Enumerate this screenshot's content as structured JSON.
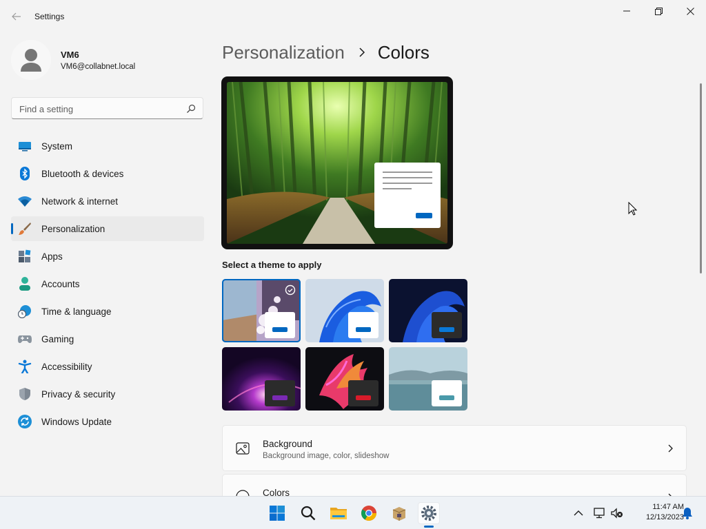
{
  "window": {
    "title": "Settings",
    "back_icon": "back-arrow-icon",
    "controls": [
      "minimize-icon",
      "restore-icon",
      "close-icon"
    ]
  },
  "profile": {
    "name": "VM6",
    "email": "VM6@collabnet.local"
  },
  "search": {
    "placeholder": "Find a setting",
    "value": ""
  },
  "nav": {
    "items": [
      {
        "label": "System",
        "icon": "system-icon",
        "selected": false
      },
      {
        "label": "Bluetooth & devices",
        "icon": "bluetooth-icon",
        "selected": false
      },
      {
        "label": "Network & internet",
        "icon": "wifi-icon",
        "selected": false
      },
      {
        "label": "Personalization",
        "icon": "paintbrush-icon",
        "selected": true
      },
      {
        "label": "Apps",
        "icon": "apps-icon",
        "selected": false
      },
      {
        "label": "Accounts",
        "icon": "person-icon",
        "selected": false
      },
      {
        "label": "Time & language",
        "icon": "globe-clock-icon",
        "selected": false
      },
      {
        "label": "Gaming",
        "icon": "gamepad-icon",
        "selected": false
      },
      {
        "label": "Accessibility",
        "icon": "accessibility-icon",
        "selected": false
      },
      {
        "label": "Privacy & security",
        "icon": "shield-icon",
        "selected": false
      },
      {
        "label": "Windows Update",
        "icon": "update-icon",
        "selected": false
      }
    ]
  },
  "breadcrumb": {
    "parent": "Personalization",
    "current": "Colors"
  },
  "themes": {
    "heading": "Select a theme to apply",
    "items": [
      {
        "name": "theme-1",
        "selected": true
      },
      {
        "name": "theme-2",
        "selected": false
      },
      {
        "name": "theme-3",
        "selected": false
      },
      {
        "name": "theme-4",
        "selected": false
      },
      {
        "name": "theme-5",
        "selected": false
      },
      {
        "name": "theme-6",
        "selected": false
      }
    ]
  },
  "rows": [
    {
      "title": "Background",
      "subtitle": "Background image, color, slideshow",
      "icon": "image-icon"
    },
    {
      "title": "Colors",
      "subtitle": "",
      "icon": "palette-icon"
    }
  ],
  "taskbar": {
    "apps": [
      "start-icon",
      "search-icon",
      "file-explorer-icon",
      "chrome-icon",
      "package-icon",
      "settings-icon"
    ],
    "time": "11:47 AM",
    "date": "12/13/2023"
  },
  "colors": {
    "accent": "#0067c0",
    "background": "#f3f3f3"
  }
}
